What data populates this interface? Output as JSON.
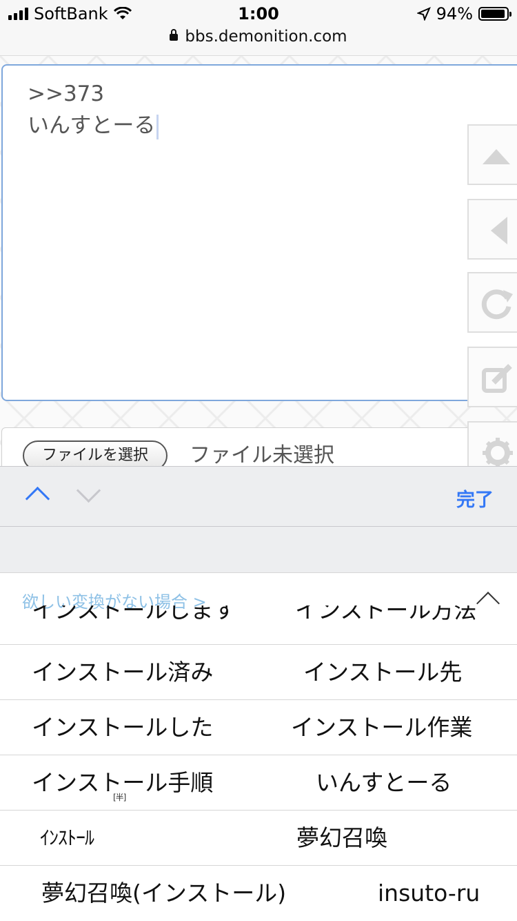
{
  "status_bar": {
    "carrier": "SoftBank",
    "time": "1:00",
    "battery": "94%",
    "battery_level": 0.94,
    "url": "bbs.demonition.com"
  },
  "editor": {
    "line1": ">>373",
    "line2": "いんすとーる",
    "file_button": "ファイルを選択",
    "file_status": "ファイル未選択"
  },
  "side_buttons": [
    {
      "icon": "arrow-up-icon"
    },
    {
      "icon": "arrow-left-icon"
    },
    {
      "icon": "reload-icon"
    },
    {
      "icon": "edit-icon"
    },
    {
      "icon": "gear-icon"
    }
  ],
  "keyboard_toolbar": {
    "done_label": "完了"
  },
  "candidates": {
    "note": "欲しい変換がない場合 >",
    "partial_row": [
      "インストールします",
      "インストール方法"
    ],
    "rows": [
      [
        "インストール済み",
        "インストール先"
      ],
      [
        "インストールした",
        "インストール作業"
      ],
      [
        "インストール手順",
        "いんすとーる"
      ],
      [
        "ｲﾝｽﾄｰﾙ",
        "夢幻召喚"
      ],
      [
        "夢幻召喚(インストール)",
        "insuto-ru"
      ]
    ],
    "halfwidth_tag": "[半]"
  },
  "colors": {
    "accent": "#3478f6",
    "textarea_border": "#7ea7dc",
    "note": "#8ec1e6"
  }
}
